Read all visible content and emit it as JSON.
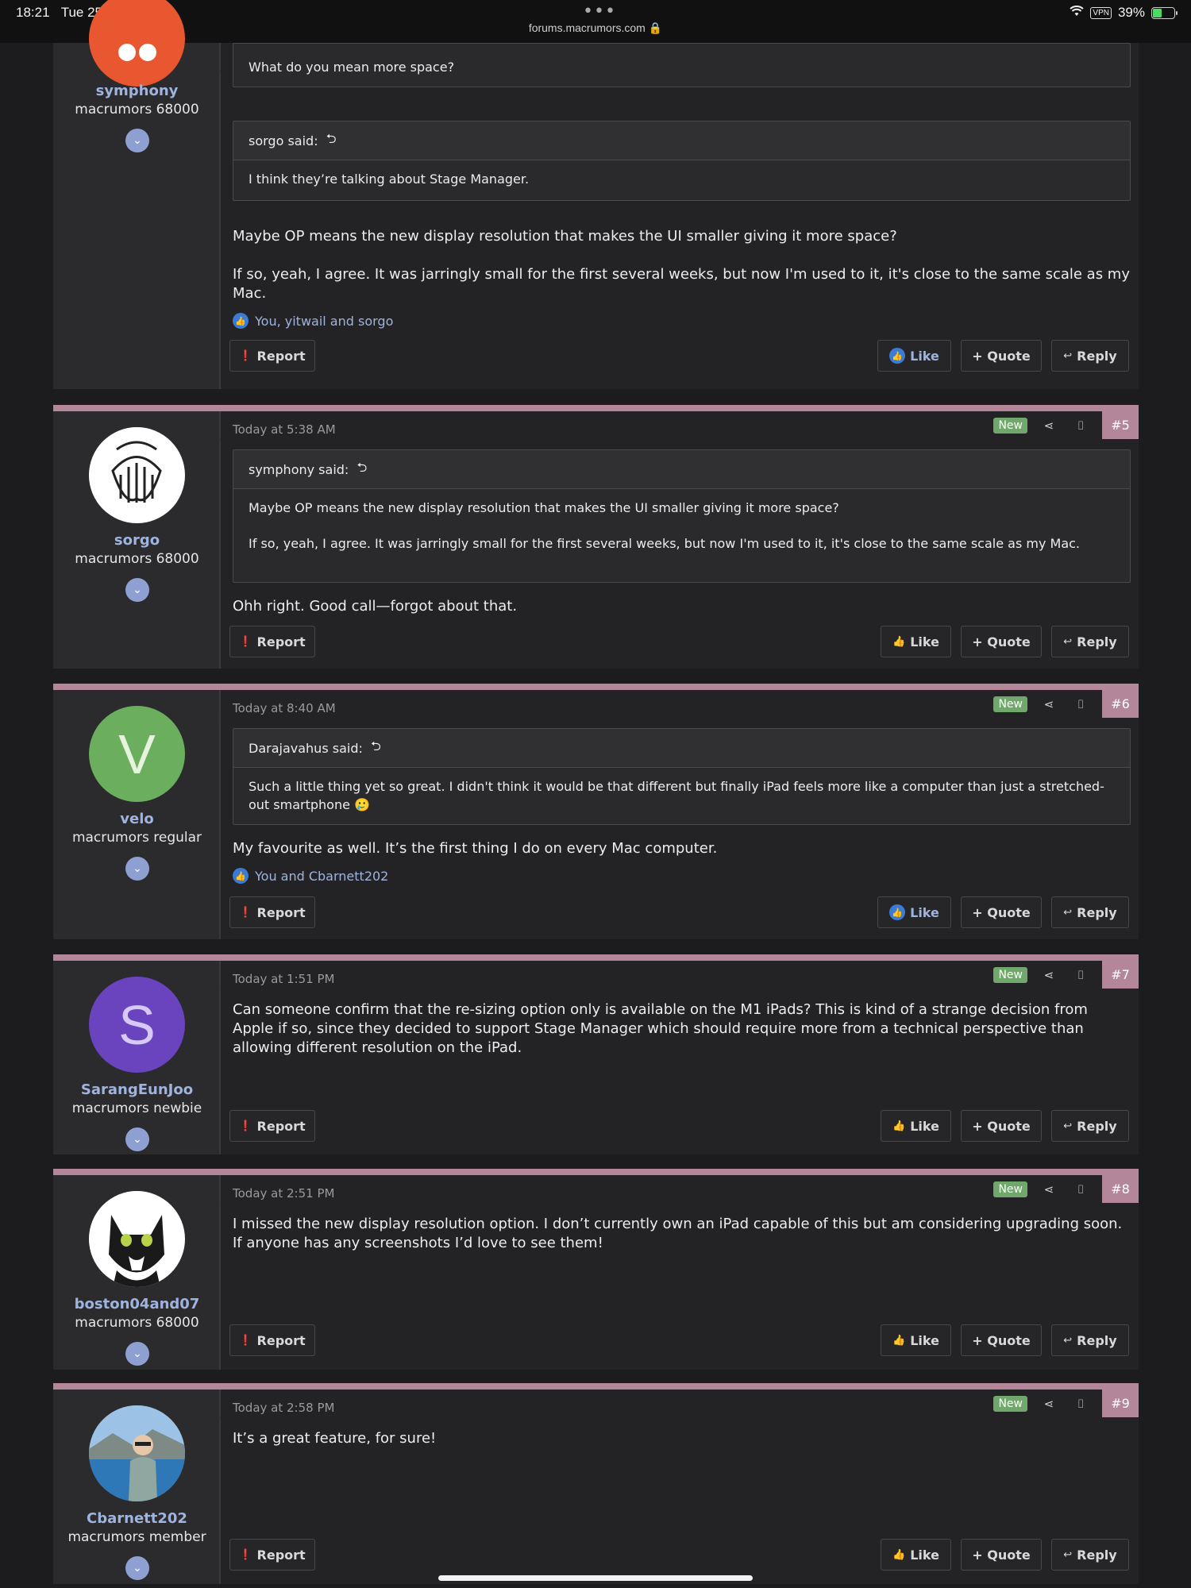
{
  "status": {
    "time": "18:21",
    "date": "Tue 25 Oct",
    "url": "forums.macrumors.com",
    "vpn": "VPN",
    "battery": "39%"
  },
  "buttons": {
    "report": "Report",
    "like": "Like",
    "quote": "+ Quote",
    "reply": "Reply"
  },
  "badge_new": "New",
  "post4": {
    "user": {
      "name": "symphony",
      "title": "macrumors 68000"
    },
    "quote_top": "What do you mean more space?",
    "quote2_author": "sorgo said:",
    "quote2_text": "I think they’re talking about Stage Manager.",
    "msg1": "Maybe OP means the new display resolution that makes the UI smaller giving it more space?",
    "msg2": "If so, yeah, I agree. It was jarringly small for the first several weeks, but now I'm used to it, it's close to the same scale as my Mac.",
    "likes": "You, yitwail and sorgo"
  },
  "post5": {
    "user": {
      "name": "sorgo",
      "title": "macrumors 68000"
    },
    "date": "Today at 5:38 AM",
    "num": "#5",
    "quote_author": "symphony said:",
    "quote_p1": "Maybe OP means the new display resolution that makes the UI smaller giving it more space?",
    "quote_p2": "If so, yeah, I agree. It was jarringly small for the first several weeks, but now I'm used to it, it's close to the same scale as my Mac.",
    "msg": "Ohh right. Good call—forgot about that."
  },
  "post6": {
    "user": {
      "name": "velo",
      "title": "macrumors regular",
      "initial": "V"
    },
    "date": "Today at 8:40 AM",
    "num": "#6",
    "quote_author": "Darajavahus said:",
    "quote_text": "Such a little thing yet so great. I didn't think it would be that different but finally iPad feels more like a computer than just a stretched-out smartphone 🥲",
    "msg": "My favourite as well. It’s the first thing I do on every Mac computer.",
    "likes": "You and Cbarnett202"
  },
  "post7": {
    "user": {
      "name": "SarangEunJoo",
      "title": "macrumors newbie",
      "initial": "S"
    },
    "date": "Today at 1:51 PM",
    "num": "#7",
    "msg": "Can someone confirm that the re-sizing option only is available on the M1 iPads? This is kind of a strange decision from Apple if so, since they decided to support Stage Manager which should require more from a technical perspective than allowing different resolution on the iPad."
  },
  "post8": {
    "user": {
      "name": "boston04and07",
      "title": "macrumors 68000"
    },
    "date": "Today at 2:51 PM",
    "num": "#8",
    "msg": "I missed the new display resolution option. I don’t currently own an iPad capable of this but am considering upgrading soon. If anyone has any screenshots I’d love to see them!"
  },
  "post9": {
    "user": {
      "name": "Cbarnett202",
      "title": "macrumors member"
    },
    "date": "Today at 2:58 PM",
    "num": "#9",
    "msg": "It’s a great feature, for sure!"
  },
  "colors": {
    "accent_pink": "#b4869a",
    "new_green": "#6fa86a",
    "username_blue": "#9fb3df",
    "avatar_velo": "#6aae5e",
    "avatar_sarang": "#6a43bf"
  }
}
